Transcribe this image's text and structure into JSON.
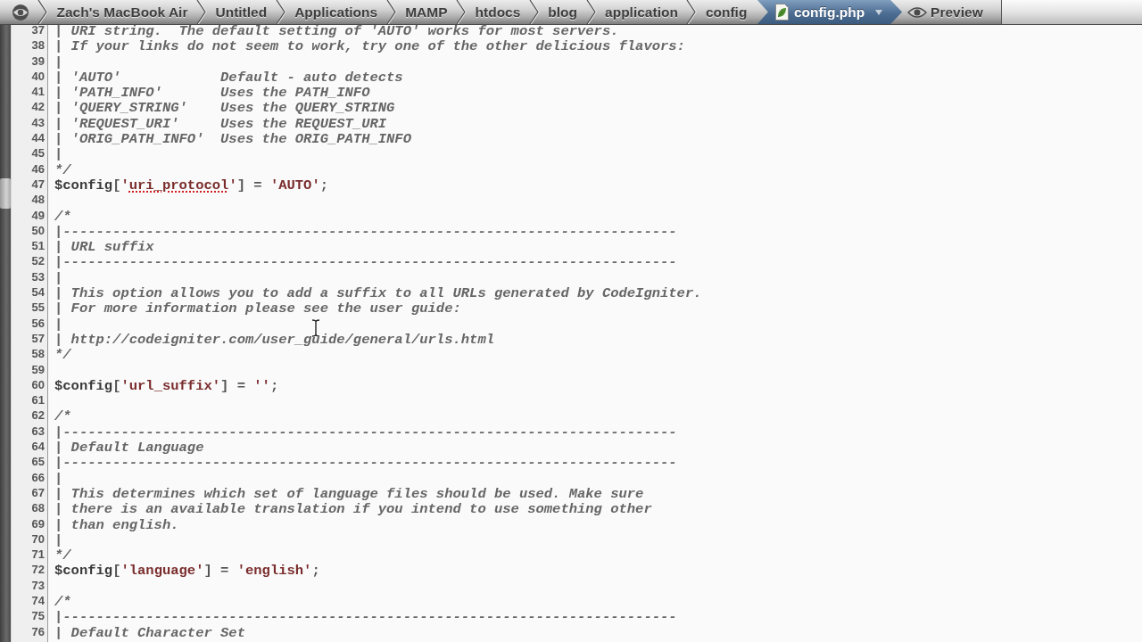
{
  "breadcrumb": {
    "items": [
      {
        "label": "Zach's MacBook Air",
        "kind": "folder",
        "selected": false
      },
      {
        "label": "Untitled",
        "kind": "folder",
        "selected": false
      },
      {
        "label": "Applications",
        "kind": "folder",
        "selected": false
      },
      {
        "label": "MAMP",
        "kind": "folder",
        "selected": false
      },
      {
        "label": "htdocs",
        "kind": "folder",
        "selected": false
      },
      {
        "label": "blog",
        "kind": "folder",
        "selected": false
      },
      {
        "label": "application",
        "kind": "folder",
        "selected": false
      },
      {
        "label": "config",
        "kind": "folder",
        "selected": false
      },
      {
        "label": "config.php",
        "kind": "file",
        "selected": true
      }
    ],
    "preview": {
      "label": "Preview"
    }
  },
  "editor": {
    "lines": [
      {
        "number": "37",
        "tokens": [
          {
            "kind": "comment",
            "text": "| URI string.  The default setting of 'AUTO' works for most servers."
          }
        ]
      },
      {
        "number": "38",
        "tokens": [
          {
            "kind": "comment",
            "text": "| If your links do not seem to work, try one of the other delicious flavors:"
          }
        ]
      },
      {
        "number": "39",
        "tokens": [
          {
            "kind": "comment",
            "text": "|"
          }
        ]
      },
      {
        "number": "40",
        "tokens": [
          {
            "kind": "comment",
            "text": "| 'AUTO'            Default - auto detects"
          }
        ]
      },
      {
        "number": "41",
        "tokens": [
          {
            "kind": "comment",
            "text": "| 'PATH_INFO'       Uses the PATH_INFO"
          }
        ]
      },
      {
        "number": "42",
        "tokens": [
          {
            "kind": "comment",
            "text": "| 'QUERY_STRING'    Uses the QUERY_STRING"
          }
        ]
      },
      {
        "number": "43",
        "tokens": [
          {
            "kind": "comment",
            "text": "| 'REQUEST_URI'     Uses the REQUEST_URI"
          }
        ]
      },
      {
        "number": "44",
        "tokens": [
          {
            "kind": "comment",
            "text": "| 'ORIG_PATH_INFO'  Uses the ORIG_PATH_INFO"
          }
        ]
      },
      {
        "number": "45",
        "tokens": [
          {
            "kind": "comment",
            "text": "|"
          }
        ]
      },
      {
        "number": "46",
        "tokens": [
          {
            "kind": "comment",
            "text": "*/"
          }
        ]
      },
      {
        "number": "47",
        "tokens": [
          {
            "kind": "variable",
            "text": "$config"
          },
          {
            "kind": "punct",
            "text": "["
          },
          {
            "kind": "string",
            "text": "'"
          },
          {
            "kind": "misspelled",
            "text": "uri_protocol"
          },
          {
            "kind": "string",
            "text": "'"
          },
          {
            "kind": "punct",
            "text": "] = "
          },
          {
            "kind": "string",
            "text": "'AUTO'"
          },
          {
            "kind": "punct",
            "text": ";"
          }
        ]
      },
      {
        "number": "48"
      },
      {
        "number": "49",
        "tokens": [
          {
            "kind": "comment",
            "text": "/*"
          }
        ]
      },
      {
        "number": "50",
        "tokens": [
          {
            "kind": "comment",
            "text": "|--------------------------------------------------------------------------"
          }
        ]
      },
      {
        "number": "51",
        "tokens": [
          {
            "kind": "comment",
            "text": "| URL suffix"
          }
        ]
      },
      {
        "number": "52",
        "tokens": [
          {
            "kind": "comment",
            "text": "|--------------------------------------------------------------------------"
          }
        ]
      },
      {
        "number": "53",
        "tokens": [
          {
            "kind": "comment",
            "text": "|"
          }
        ]
      },
      {
        "number": "54",
        "tokens": [
          {
            "kind": "comment",
            "text": "| This option allows you to add a suffix to all URLs generated by CodeIgniter."
          }
        ]
      },
      {
        "number": "55",
        "tokens": [
          {
            "kind": "comment",
            "text": "| For more information please see the user guide:"
          }
        ]
      },
      {
        "number": "56",
        "tokens": [
          {
            "kind": "comment",
            "text": "|"
          }
        ]
      },
      {
        "number": "57",
        "tokens": [
          {
            "kind": "comment",
            "text": "| http://codeigniter.com/user_guide/general/urls.html"
          }
        ]
      },
      {
        "number": "58",
        "tokens": [
          {
            "kind": "comment",
            "text": "*/"
          }
        ]
      },
      {
        "number": "59"
      },
      {
        "number": "60",
        "tokens": [
          {
            "kind": "variable",
            "text": "$config"
          },
          {
            "kind": "punct",
            "text": "["
          },
          {
            "kind": "string",
            "text": "'url_suffix'"
          },
          {
            "kind": "punct",
            "text": "] = "
          },
          {
            "kind": "string",
            "text": "''"
          },
          {
            "kind": "punct",
            "text": ";"
          }
        ]
      },
      {
        "number": "61"
      },
      {
        "number": "62",
        "tokens": [
          {
            "kind": "comment",
            "text": "/*"
          }
        ]
      },
      {
        "number": "63",
        "tokens": [
          {
            "kind": "comment",
            "text": "|--------------------------------------------------------------------------"
          }
        ]
      },
      {
        "number": "64",
        "tokens": [
          {
            "kind": "comment",
            "text": "| Default Language"
          }
        ]
      },
      {
        "number": "65",
        "tokens": [
          {
            "kind": "comment",
            "text": "|--------------------------------------------------------------------------"
          }
        ]
      },
      {
        "number": "66",
        "tokens": [
          {
            "kind": "comment",
            "text": "|"
          }
        ]
      },
      {
        "number": "67",
        "tokens": [
          {
            "kind": "comment",
            "text": "| This determines which set of language files should be used. Make sure"
          }
        ]
      },
      {
        "number": "68",
        "tokens": [
          {
            "kind": "comment",
            "text": "| there is an available translation if you intend to use something other"
          }
        ]
      },
      {
        "number": "69",
        "tokens": [
          {
            "kind": "comment",
            "text": "| than english."
          }
        ]
      },
      {
        "number": "70",
        "tokens": [
          {
            "kind": "comment",
            "text": "|"
          }
        ]
      },
      {
        "number": "71",
        "tokens": [
          {
            "kind": "comment",
            "text": "*/"
          }
        ]
      },
      {
        "number": "72",
        "tokens": [
          {
            "kind": "variable",
            "text": "$config"
          },
          {
            "kind": "punct",
            "text": "["
          },
          {
            "kind": "string",
            "text": "'language'"
          },
          {
            "kind": "punct",
            "text": "] = "
          },
          {
            "kind": "string",
            "text": "'english'"
          },
          {
            "kind": "punct",
            "text": ";"
          }
        ]
      },
      {
        "number": "73"
      },
      {
        "number": "74",
        "tokens": [
          {
            "kind": "comment",
            "text": "/*"
          }
        ]
      },
      {
        "number": "75",
        "tokens": [
          {
            "kind": "comment",
            "text": "|--------------------------------------------------------------------------"
          }
        ]
      },
      {
        "number": "76",
        "tokens": [
          {
            "kind": "comment",
            "text": "| Default Character Set"
          }
        ]
      }
    ]
  }
}
